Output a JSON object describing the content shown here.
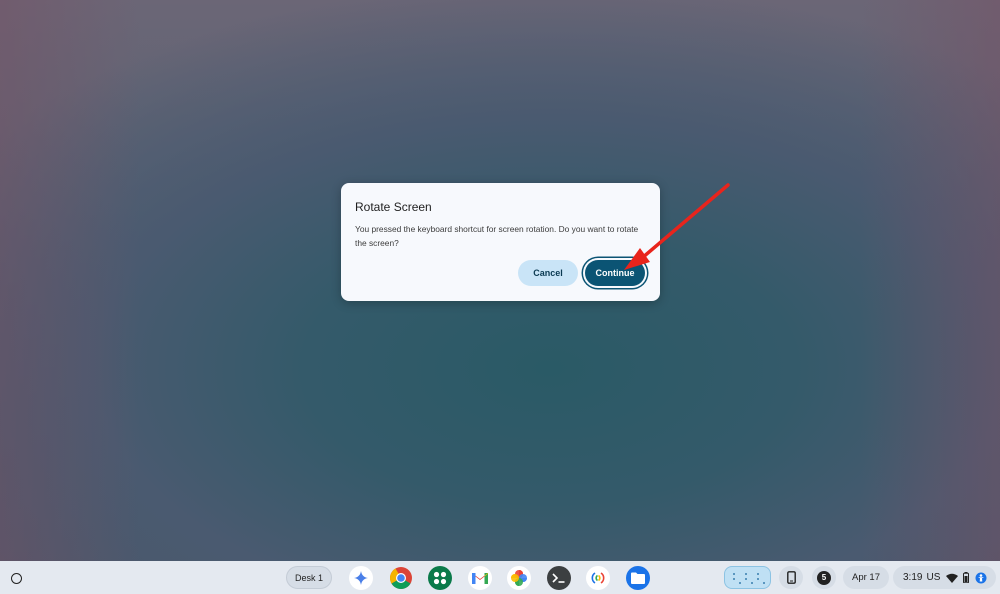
{
  "dialog": {
    "title": "Rotate Screen",
    "message": "You pressed the keyboard shortcut for screen rotation. Do you want to rotate the screen?",
    "cancel_label": "Cancel",
    "continue_label": "Continue"
  },
  "shelf": {
    "desk_label": "Desk 1",
    "apps": [
      {
        "name": "gemini",
        "icon": "sparkle-icon"
      },
      {
        "name": "chrome",
        "icon": "chrome-icon"
      },
      {
        "name": "app-grid",
        "icon": "dots-grid-icon"
      },
      {
        "name": "gmail",
        "icon": "gmail-icon"
      },
      {
        "name": "photos",
        "icon": "pinwheel-icon"
      },
      {
        "name": "terminal",
        "icon": "terminal-icon"
      },
      {
        "name": "wifi-sync",
        "icon": "nearby-icon"
      },
      {
        "name": "files",
        "icon": "folder-icon"
      }
    ],
    "tray": {
      "notification_count": "5",
      "date": "Apr 17",
      "time": "3:19",
      "input_method": "US"
    }
  },
  "colors": {
    "accent": "#0b5474",
    "cancel_bg": "#c9e4f7",
    "annotation_arrow": "#e8241c"
  }
}
